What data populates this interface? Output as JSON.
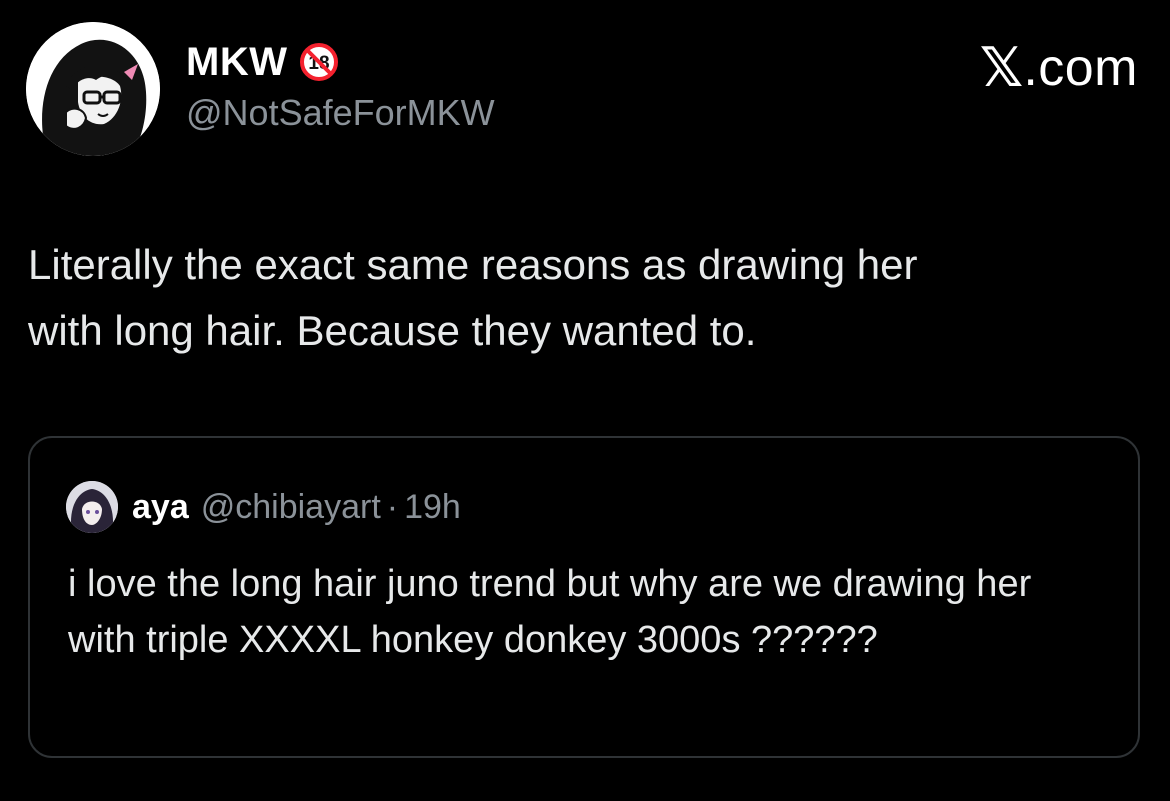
{
  "author": {
    "display_name": "MKW",
    "handle": "@NotSafeForMKW",
    "badge_icon": "no-under-18-icon",
    "avatar_icon": "anime-avatar-icon"
  },
  "brand": {
    "x_glyph": "𝕏",
    "suffix": ".com"
  },
  "tweet": {
    "text": "Literally the exact same reasons as drawing her\nwith long hair. Because they wanted to."
  },
  "quote": {
    "display_name": "aya",
    "handle": "@chibiayart",
    "separator": "·",
    "time": "19h",
    "avatar_icon": "anime-avatar-icon",
    "text": "i love the long hair juno trend but why are we drawing her with triple XXXXL honkey donkey 3000s ??????"
  },
  "colors": {
    "background": "#000000",
    "text_primary": "#e7e9ea",
    "text_secondary": "#8b9299",
    "border": "#2f3336",
    "badge_red": "#f4212e"
  }
}
